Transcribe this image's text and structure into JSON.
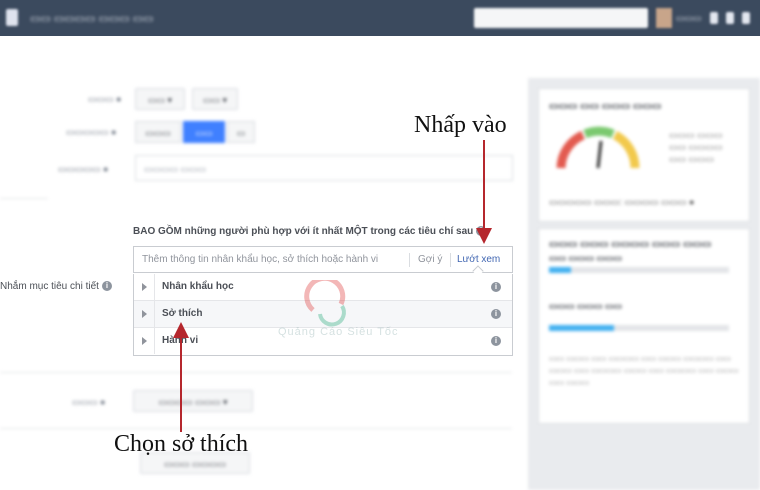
{
  "targeting": {
    "include_heading": "BAO GỒM những người phù hợp với ít nhất MỘT trong các tiêu chí sau",
    "detailed_label": "Nhắm mục tiêu chi tiết",
    "input_placeholder": "Thêm thông tin nhân khẩu học, sở thích hoặc hành vi",
    "suggest_label": "Gợi ý",
    "browse_label": "Lướt xem",
    "categories": [
      {
        "label": "Nhân khẩu học"
      },
      {
        "label": "Sở thích"
      },
      {
        "label": "Hành vi"
      }
    ]
  },
  "annotations": {
    "click_here": "Nhấp vào",
    "choose_interests": "Chọn sở thích"
  },
  "watermark": {
    "text": "Quảng Cáo Siêu Tốc"
  },
  "colors": {
    "topbar": "#3b4a5e",
    "accent_blue": "#4080ff",
    "link_blue": "#4267b2",
    "arrow_red": "#b5272d",
    "panel_bg": "#e9ebee",
    "progress_blue": "#42b0f0"
  },
  "icons": {
    "info": "info-icon",
    "expand": "triangle-right-icon"
  }
}
